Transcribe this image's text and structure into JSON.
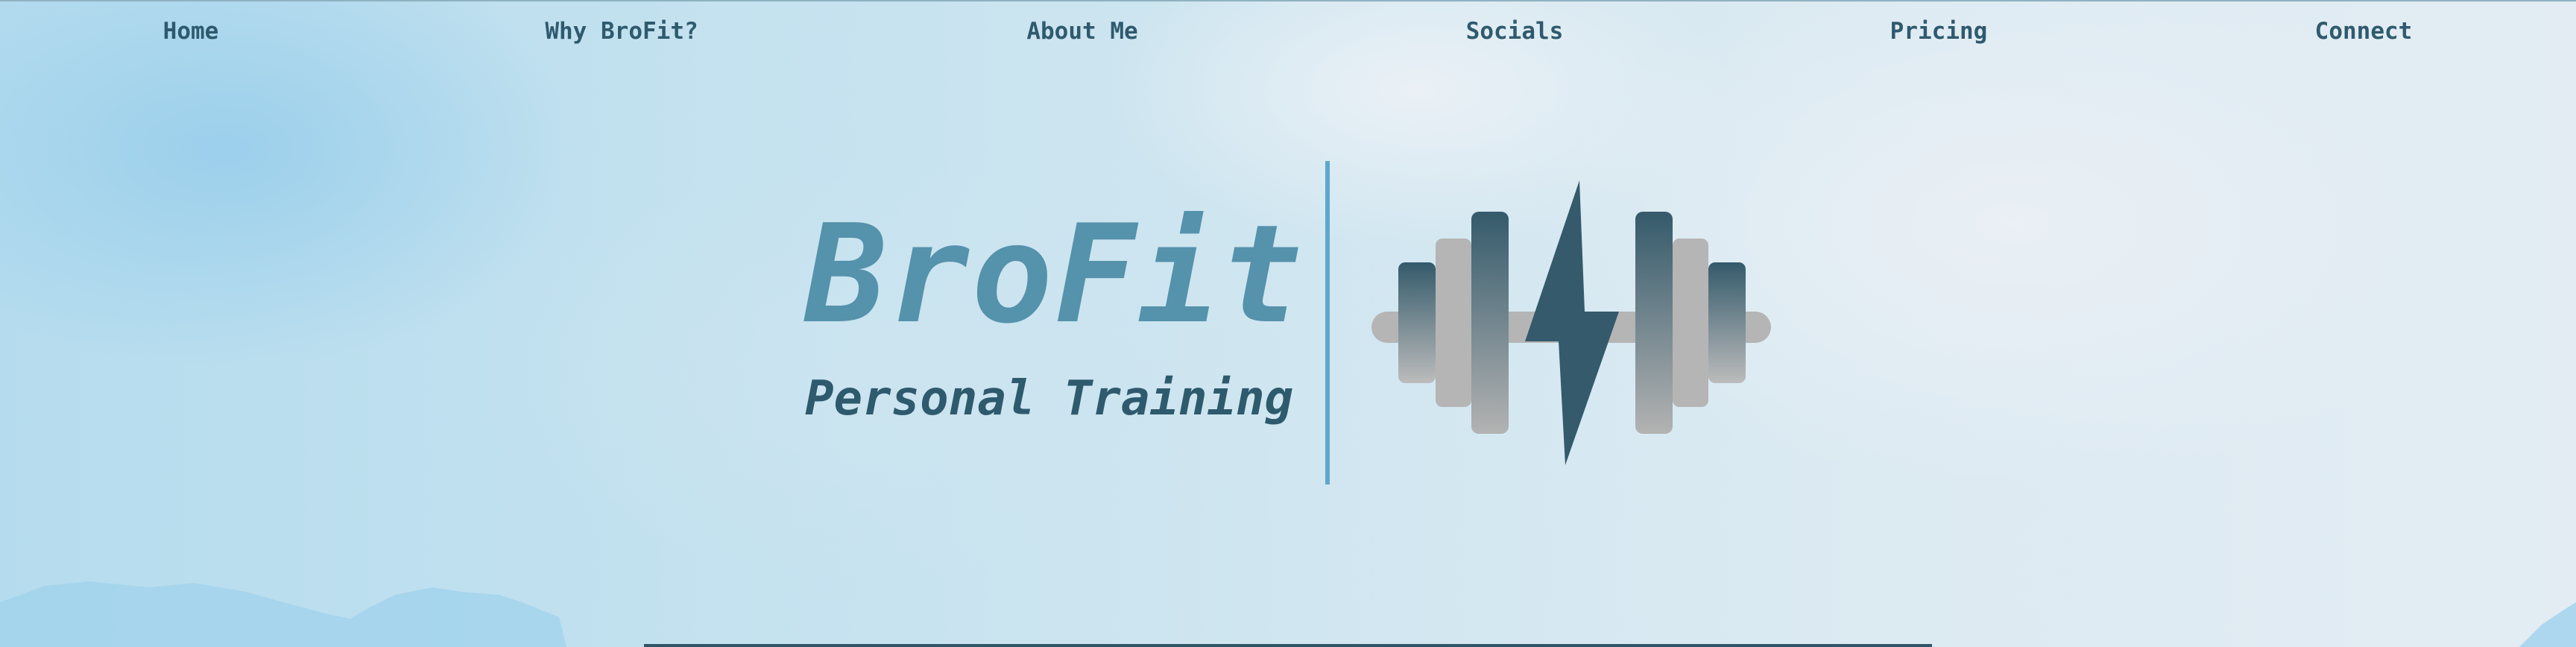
{
  "nav": {
    "items": [
      {
        "label": "Home"
      },
      {
        "label": "Why BroFit?"
      },
      {
        "label": "About Me"
      },
      {
        "label": "Socials"
      },
      {
        "label": "Pricing"
      },
      {
        "label": "Connect"
      }
    ]
  },
  "hero": {
    "title": "BroFit",
    "subtitle": "Personal Training",
    "logo_icon": "dumbbell-lightning-icon"
  },
  "colors": {
    "nav_text": "#2f5a6e",
    "title": "#5592ab",
    "subtitle": "#2e5a6d",
    "divider": "#5ea7cc",
    "dark_accent": "#345a6b",
    "plate_gray": "#b3b3b3"
  }
}
